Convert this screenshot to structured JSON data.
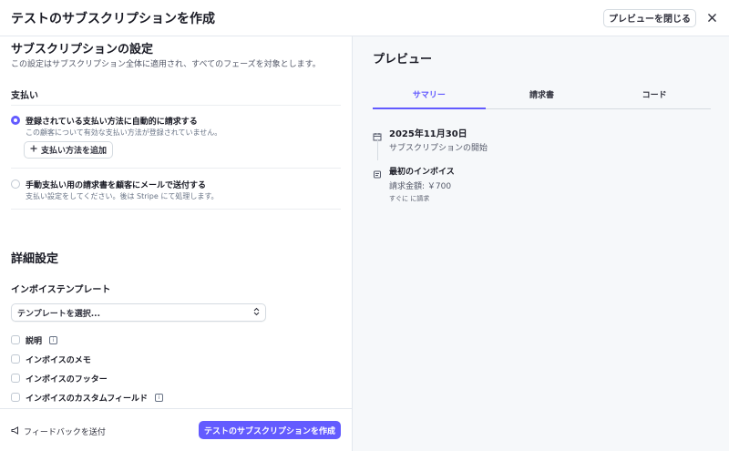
{
  "header": {
    "title": "テストのサブスクリプションを作成",
    "close_preview_label": "プレビューを閉じる"
  },
  "settings": {
    "title": "サブスクリプションの設定",
    "description": "この設定はサブスクリプション全体に適用され、すべてのフェーズを対象とします。",
    "payment_heading": "支払い",
    "options": [
      {
        "title": "登録されている支払い方法に自動的に請求する",
        "subtitle": "この顧客について有効な支払い方法が登録されていません。",
        "selected": true
      },
      {
        "title": "手動支払い用の請求書を顧客にメールで送付する",
        "subtitle": "支払い設定をしてください。後は Stripe にて処理します。",
        "selected": false
      }
    ],
    "add_payment_label": "支払い方法を追加"
  },
  "details": {
    "title": "詳細設定",
    "template_heading": "インボイステンプレート",
    "template_select_value": "テンプレートを選択...",
    "checkboxes": [
      {
        "label": "説明",
        "info": true
      },
      {
        "label": "インボイスのメモ",
        "info": false
      },
      {
        "label": "インボイスのフッター",
        "info": false
      },
      {
        "label": "インボイスのカスタムフィールド",
        "info": true
      }
    ]
  },
  "footer": {
    "feedback_label": "フィードバックを送付",
    "create_label": "テストのサブスクリプションを作成"
  },
  "preview": {
    "title": "プレビュー",
    "tabs": [
      {
        "label": "サマリー",
        "active": true
      },
      {
        "label": "請求書",
        "active": false
      },
      {
        "label": "コード",
        "active": false
      }
    ],
    "timeline": [
      {
        "icon": "calendar-icon",
        "title": "2025年11月30日",
        "subtitle": "サブスクリプションの開始"
      },
      {
        "icon": "invoice-icon",
        "title": "最初のインボイス",
        "subtitle": "請求金額: ￥700",
        "note": "すぐに に請求"
      }
    ]
  },
  "colors": {
    "accent": "#635bff",
    "preview_bg": "#f6f8fa",
    "border": "#e3e8ee"
  }
}
